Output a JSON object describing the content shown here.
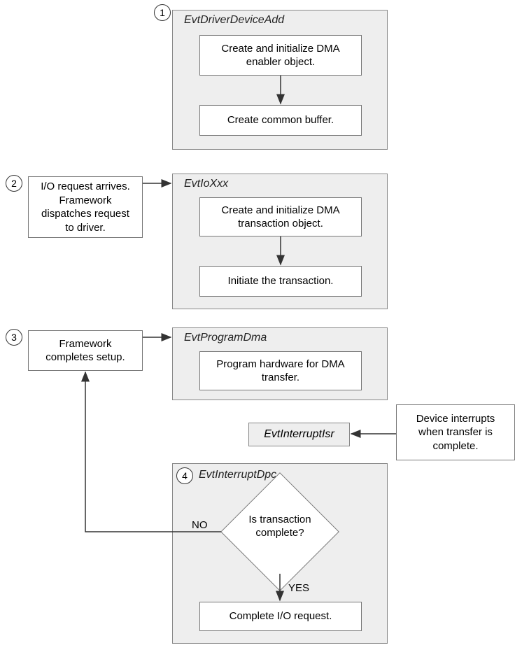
{
  "numbers": {
    "n1": "1",
    "n2": "2",
    "n3": "3",
    "n4": "4"
  },
  "panels": {
    "p1": {
      "title": "EvtDriverDeviceAdd",
      "box1": "Create and initialize DMA enabler object.",
      "box2": "Create common buffer."
    },
    "p2": {
      "title": "EvtIoXxx",
      "box1": "Create and initialize DMA transaction object.",
      "box2": "Initiate the transaction."
    },
    "p3": {
      "title": "EvtProgramDma",
      "box1": "Program hardware for DMA transfer."
    },
    "p4": {
      "title": "EvtInterruptDpc",
      "diamond": "Is transaction complete?",
      "box_complete": "Complete I/O request."
    }
  },
  "side": {
    "s2": "I/O request arrives. Framework dispatches request to driver.",
    "s3": "Framework completes setup.",
    "s_interrupt": "Device interrupts when transfer is complete."
  },
  "isr": "EvtInterruptIsr",
  "labels": {
    "no": "NO",
    "yes": "YES"
  }
}
